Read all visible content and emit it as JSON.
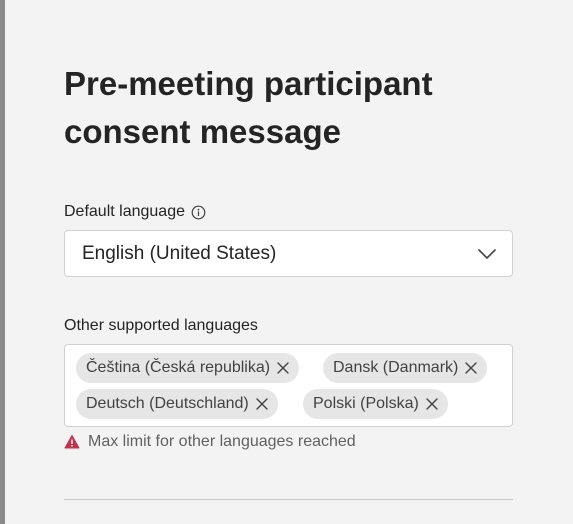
{
  "panel": {
    "title": "Pre-meeting participant consent message"
  },
  "default_language": {
    "label": "Default language",
    "info_icon": "info-icon",
    "selected": "English (United States)",
    "chevron_icon": "chevron-down-icon"
  },
  "other_languages": {
    "label": "Other supported languages",
    "tags": [
      {
        "label": "Čeština (Česká republika)"
      },
      {
        "label": "Dansk (Danmark)"
      },
      {
        "label": "Deutsch (Deutschland)"
      },
      {
        "label": "Polski (Polska)"
      }
    ],
    "remove_icon": "close-icon",
    "error_message": "Max limit for other languages reached",
    "error_icon": "warning-icon",
    "error_color": "#c4314b"
  }
}
